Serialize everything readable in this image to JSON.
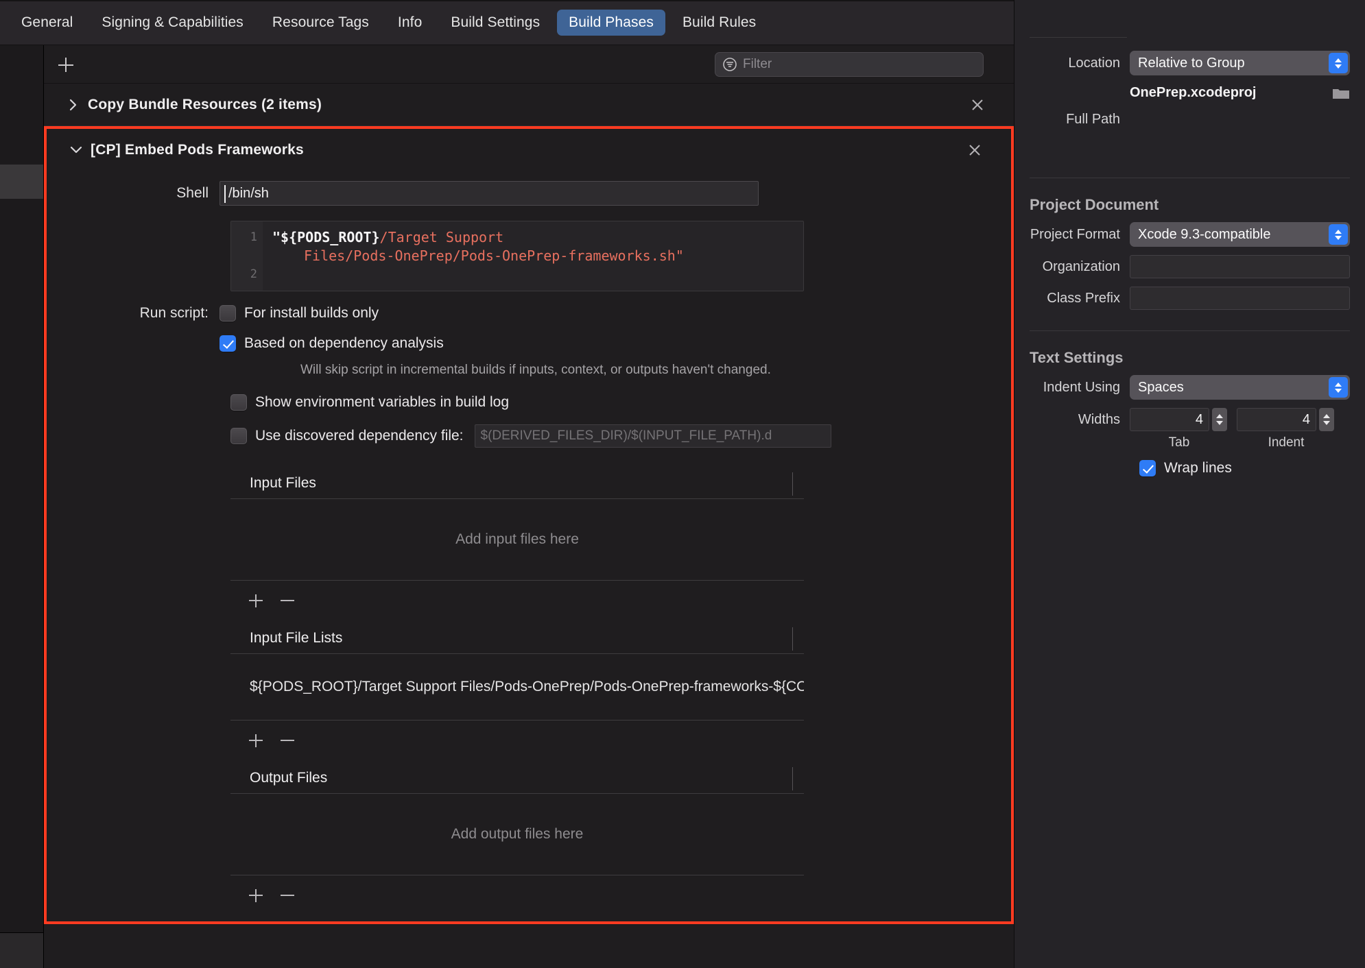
{
  "tabs": [
    {
      "label": "General",
      "active": false
    },
    {
      "label": "Signing & Capabilities",
      "active": false
    },
    {
      "label": "Resource Tags",
      "active": false
    },
    {
      "label": "Info",
      "active": false
    },
    {
      "label": "Build Settings",
      "active": false
    },
    {
      "label": "Build Phases",
      "active": true
    },
    {
      "label": "Build Rules",
      "active": false
    }
  ],
  "toolbar": {
    "add_label": "+",
    "filter_placeholder": "Filter"
  },
  "phases": {
    "collapsed": {
      "title": "Copy Bundle Resources (2 items)"
    },
    "expanded": {
      "title": "[CP] Embed Pods Frameworks",
      "shell_label": "Shell",
      "shell_value": "/bin/sh",
      "code": {
        "line1_number": "1",
        "line2_number": "2",
        "line1_white": "\"${PODS_ROOT}",
        "line1_red": "/Target Support",
        "line1_wrap_red": "Files/Pods-OnePrep/Pods-OnePrep-frameworks.sh\""
      },
      "run_script_label": "Run script:",
      "checkbox_install_only": {
        "label": "For install builds only",
        "checked": false
      },
      "checkbox_dependency_analysis": {
        "label": "Based on dependency analysis",
        "checked": true
      },
      "dependency_hint": "Will skip script in incremental builds if inputs, context, or outputs haven't changed.",
      "checkbox_show_env": {
        "label": "Show environment variables in build log",
        "checked": false
      },
      "checkbox_discovered_dep": {
        "label": "Use discovered dependency file:",
        "checked": false
      },
      "discovered_dep_placeholder": "$(DERIVED_FILES_DIR)/$(INPUT_FILE_PATH).d",
      "sections": [
        {
          "title": "Input Files",
          "empty_text": "Add input files here",
          "entries": []
        },
        {
          "title": "Input File Lists",
          "empty_text": "",
          "entries": [
            "${PODS_ROOT}/Target Support Files/Pods-OnePrep/Pods-OnePrep-frameworks-${CONFIG…"
          ]
        },
        {
          "title": "Output Files",
          "empty_text": "Add output files here",
          "entries": []
        }
      ]
    }
  },
  "inspector": {
    "location_label": "Location",
    "location_value": "Relative to Group",
    "project_file_name": "OnePrep.xcodeproj",
    "full_path_label": "Full Path",
    "full_path_value": "",
    "project_document": {
      "title": "Project Document",
      "project_format_label": "Project Format",
      "project_format_value": "Xcode 9.3-compatible",
      "organization_label": "Organization",
      "organization_value": "",
      "class_prefix_label": "Class Prefix",
      "class_prefix_value": ""
    },
    "text_settings": {
      "title": "Text Settings",
      "indent_using_label": "Indent Using",
      "indent_using_value": "Spaces",
      "widths_label": "Widths",
      "tab_width": "4",
      "indent_width": "4",
      "tab_sublabel": "Tab",
      "indent_sublabel": "Indent",
      "wrap_lines_label": "Wrap lines",
      "wrap_lines_checked": true
    }
  },
  "colors": {
    "accent_blue": "#2f7cf6",
    "highlight_red": "#ff3b21",
    "code_string": "#e8705f",
    "tab_active_bg": "#3f6496"
  }
}
